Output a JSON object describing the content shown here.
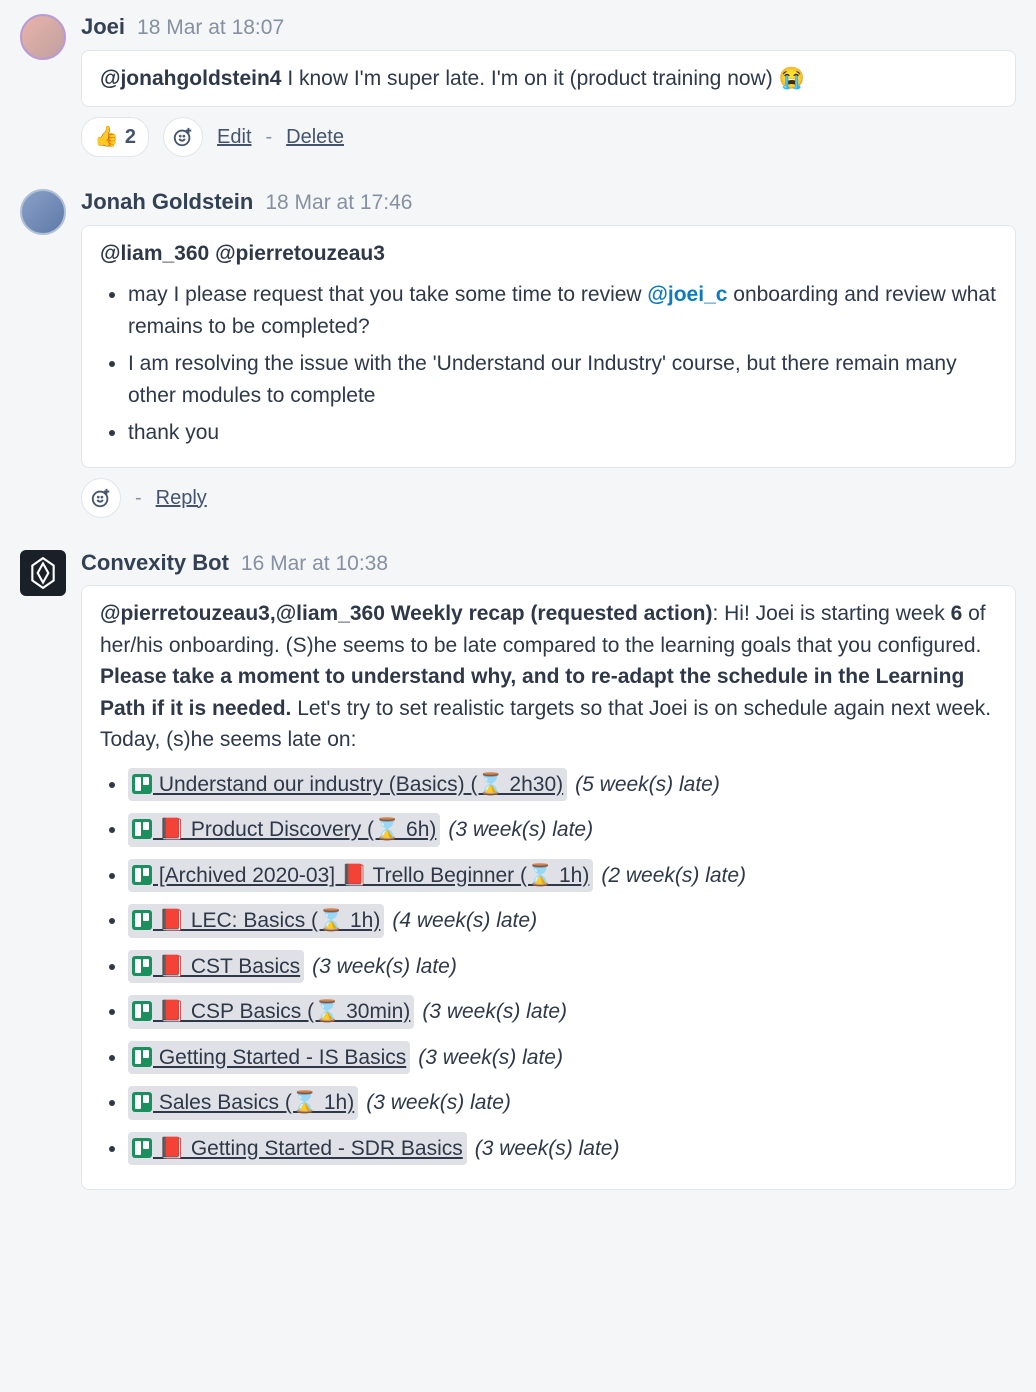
{
  "messages": {
    "m1": {
      "author": "Joei",
      "ts": "18 Mar at 18:07",
      "mention": "@jonahgoldstein4",
      "text": " I know I'm super late. I'm on it (product training now) 😭",
      "reaction_emoji": "👍",
      "reaction_count": "2",
      "edit": "Edit",
      "delete": "Delete"
    },
    "m2": {
      "author": "Jonah Goldstein",
      "ts": "18 Mar at 17:46",
      "mention1": "@liam_360",
      "mention2": "@pierretouzeau3",
      "li1a": "may I please request that you take some time to review ",
      "li1_mention": "@joei_c",
      "li1b": " onboarding and review what remains to be completed?",
      "li2": "I am resolving the issue with the 'Understand our Industry' course, but there remain many other modules to complete",
      "li3": "thank you",
      "reply": "Reply"
    },
    "m3": {
      "author": "Convexity Bot",
      "ts": "16 Mar at 10:38",
      "intro_mentions": "@pierretouzeau3,@liam_360",
      "intro_title": " Weekly recap (requested action)",
      "intro_a": ": Hi! Joei is starting week ",
      "week": "6",
      "intro_b": " of her/his onboarding. (S)he seems to be late compared to the learning goals that you configured. ",
      "intro_bold": "Please take a moment to understand why, and to re-adapt the schedule in the Learning Path if it is needed.",
      "intro_c": " Let's try to set realistic targets so that Joei is on schedule again next week. Today, (s)he seems late on:",
      "items": {
        "i1": {
          "label": " Understand our industry (Basics)  (⌛  2h30) ",
          "late": "(5 week(s) late)"
        },
        "i2": {
          "label": " 📕  Product Discovery (⌛  6h) ",
          "late": "(3 week(s) late)"
        },
        "i3": {
          "label": " [Archived 2020-03] 📕  Trello Beginner (⌛  1h) ",
          "late": "(2 week(s) late)"
        },
        "i4": {
          "label": " 📕  LEC: Basics (⌛  1h) ",
          "late": "(4 week(s) late)"
        },
        "i5": {
          "label": " 📕  CST Basics ",
          "late": "(3 week(s) late)"
        },
        "i6": {
          "label": " 📕  CSP Basics (⌛  30min) ",
          "late": "(3 week(s) late)"
        },
        "i7": {
          "label": " Getting Started - IS Basics ",
          "late": "(3 week(s) late)"
        },
        "i8": {
          "label": " Sales Basics (⌛  1h) ",
          "late": "(3 week(s) late)"
        },
        "i9": {
          "label": " 📕  Getting Started - SDR Basics ",
          "late": "(3 week(s) late)"
        }
      }
    }
  }
}
